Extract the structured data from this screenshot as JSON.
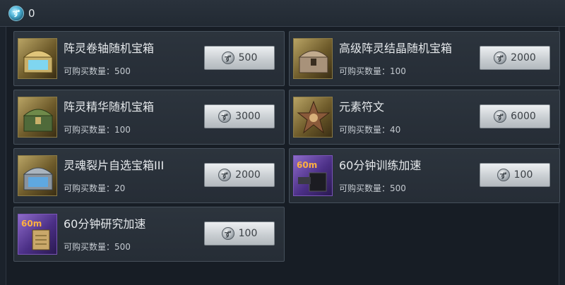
{
  "header": {
    "currency_icon": "blue-crystal-coin-icon",
    "currency_amount": "0"
  },
  "price_icon": "silver-coin-icon",
  "items": [
    {
      "name": "阵灵卷轴随机宝箱",
      "limit": "可购买数量：500",
      "price": "500",
      "icon": "gold-chest-icon"
    },
    {
      "name": "高级阵灵结晶随机宝箱",
      "limit": "可购买数量：100",
      "price": "2000",
      "icon": "ornate-chest-icon"
    },
    {
      "name": "阵灵精华随机宝箱",
      "limit": "可购买数量：100",
      "price": "3000",
      "icon": "jade-chest-icon"
    },
    {
      "name": "元素符文",
      "limit": "可购买数量：40",
      "price": "6000",
      "icon": "rune-star-icon"
    },
    {
      "name": "灵魂裂片自选宝箱III",
      "limit": "可购买数量：20",
      "price": "2000",
      "icon": "silver-chest-icon"
    },
    {
      "name": "60分钟训练加速",
      "limit": "可购买数量：500",
      "price": "100",
      "icon": "training-speedup-icon",
      "badge": "60m"
    },
    {
      "name": "60分钟研究加速",
      "limit": "可购买数量：500",
      "price": "100",
      "icon": "research-speedup-icon",
      "badge": "60m"
    }
  ]
}
